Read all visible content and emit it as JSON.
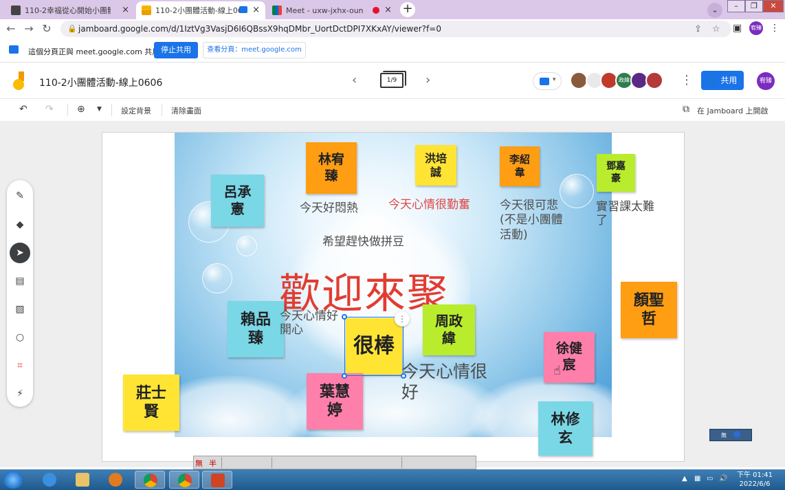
{
  "browser": {
    "tabs": [
      {
        "title": "110-2幸福從心開始小團體輔導手"
      },
      {
        "title": "110-2小團體活動-線上0606"
      },
      {
        "title": "Meet - uxw-jxhx-oun"
      }
    ],
    "url": "jamboard.google.com/d/1IztVg3VasjD6I6QBssX9hqDMbr_UortDctDPI7XKxAY/viewer?f=0",
    "profile_initials": "宥臻"
  },
  "sharebar": {
    "message": "這個分頁正與 meet.google.com 共用",
    "stop_label": "停止共用",
    "view_label": "查看分頁：meet.google.com"
  },
  "jam": {
    "title": "110-2小團體活動-線上0606",
    "page": "1/9",
    "share_label": "共用",
    "me_initials": "宥臻",
    "collab_label": "政緯",
    "toolbar": {
      "set_bg": "設定背景",
      "clear": "清除畫面",
      "open_in": "在 Jamboard 上開啟"
    }
  },
  "board": {
    "welcome": "歡迎來聚",
    "notes": {
      "lin_you_zhen": "林宥\n臻",
      "hong_pei_cheng": "洪培\n誠",
      "li_shao_wei": "李紹\n韋",
      "deng_jia_hao": "鄧嘉\n豪",
      "lu_cheng_xian": "呂承\n憲",
      "yan_sheng_zhe": "顏聖\n哲",
      "lai_pin_zhen": "賴品\n臻",
      "hen_bang": "很棒",
      "zhou_zheng_wei": "周政\n緯",
      "xu_jian_chen": "徐健\n宸",
      "zhuang_shi_xian": "莊士\n賢",
      "ye_hui_ting": "葉慧\n婷",
      "lin_xiu_xuan": "林修\n玄"
    },
    "texts": {
      "hot": "今天好悶熱",
      "diligent": "今天心情很勤奮",
      "sad": "今天很可悲\n(不是小團體\n活動)",
      "hard": "實習課太難\n了",
      "beads": "希望趕快做拼豆",
      "happy": "今天心情好\n開心",
      "good": "今天心情很\n好"
    }
  },
  "ime": {
    "label1": "無",
    "label2": "半"
  },
  "floater": {
    "label": "無"
  },
  "taskbar": {
    "time": "下午 01:41",
    "date": "2022/6/6"
  },
  "colors": {
    "accent": "#1a73e8",
    "welcome": "#e23c32",
    "note_orange": "#ff9d13",
    "note_yellow": "#ffe434",
    "note_cyan": "#7ad7e6",
    "note_pink": "#ff7fab",
    "note_green": "#b9ec2c"
  }
}
